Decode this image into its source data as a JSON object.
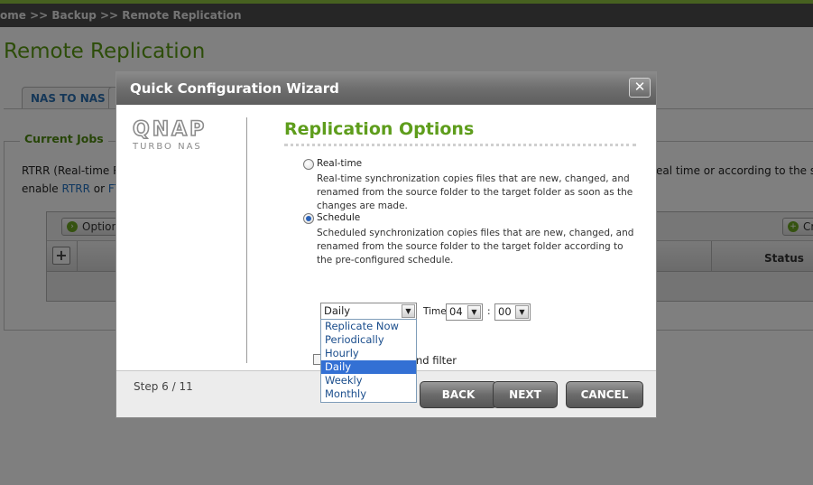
{
  "breadcrumb": "ome >> Backup >> Remote Replication",
  "page_title": "Remote Replication",
  "tabs": [
    {
      "label": "NAS TO NAS"
    },
    {
      "label": ""
    }
  ],
  "current_jobs": {
    "legend": "Current Jobs",
    "desc_line1": "RTRR (Real-time R",
    "desc_line2_prefix": "enable ",
    "desc_link1": "RTRR",
    "desc_or": " or ",
    "desc_link2": "FT",
    "desc_right": "eal time or according to the spec",
    "options_label": "Option",
    "create_label": "Cr",
    "status_header": "Status"
  },
  "dialog": {
    "title": "Quick Configuration Wizard",
    "close_glyph": "✕",
    "logo_main": "QNAP",
    "logo_sub": "TURBO NAS",
    "section_title": "Replication Options",
    "realtime_label": "Real-time",
    "realtime_desc": "Real-time synchronization copies files that are new, changed, and renamed from the source folder to the target folder as soon as the changes are made.",
    "schedule_label": "Schedule",
    "schedule_desc": "Scheduled synchronization copies files that are new, changed, and renamed from the source folder to the target folder according to the pre-configured schedule.",
    "frequency_value": "Daily",
    "time_label": "Time",
    "hour_value": "04",
    "minute_value": "00",
    "time_separator": ":",
    "frequency_options": [
      "Replicate Now",
      "Periodically",
      "Hourly",
      "Daily",
      "Weekly",
      "Monthly"
    ],
    "selected_option_index": 3,
    "filter_label_partial": "nd filter",
    "step_text": "Step 6 / 11",
    "buttons": {
      "back": "BACK",
      "next": "NEXT",
      "cancel": "CANCEL"
    }
  },
  "colors": {
    "accent_green": "#5e9d1c",
    "link_blue": "#1f6fc1",
    "selection_blue": "#3370d4"
  }
}
